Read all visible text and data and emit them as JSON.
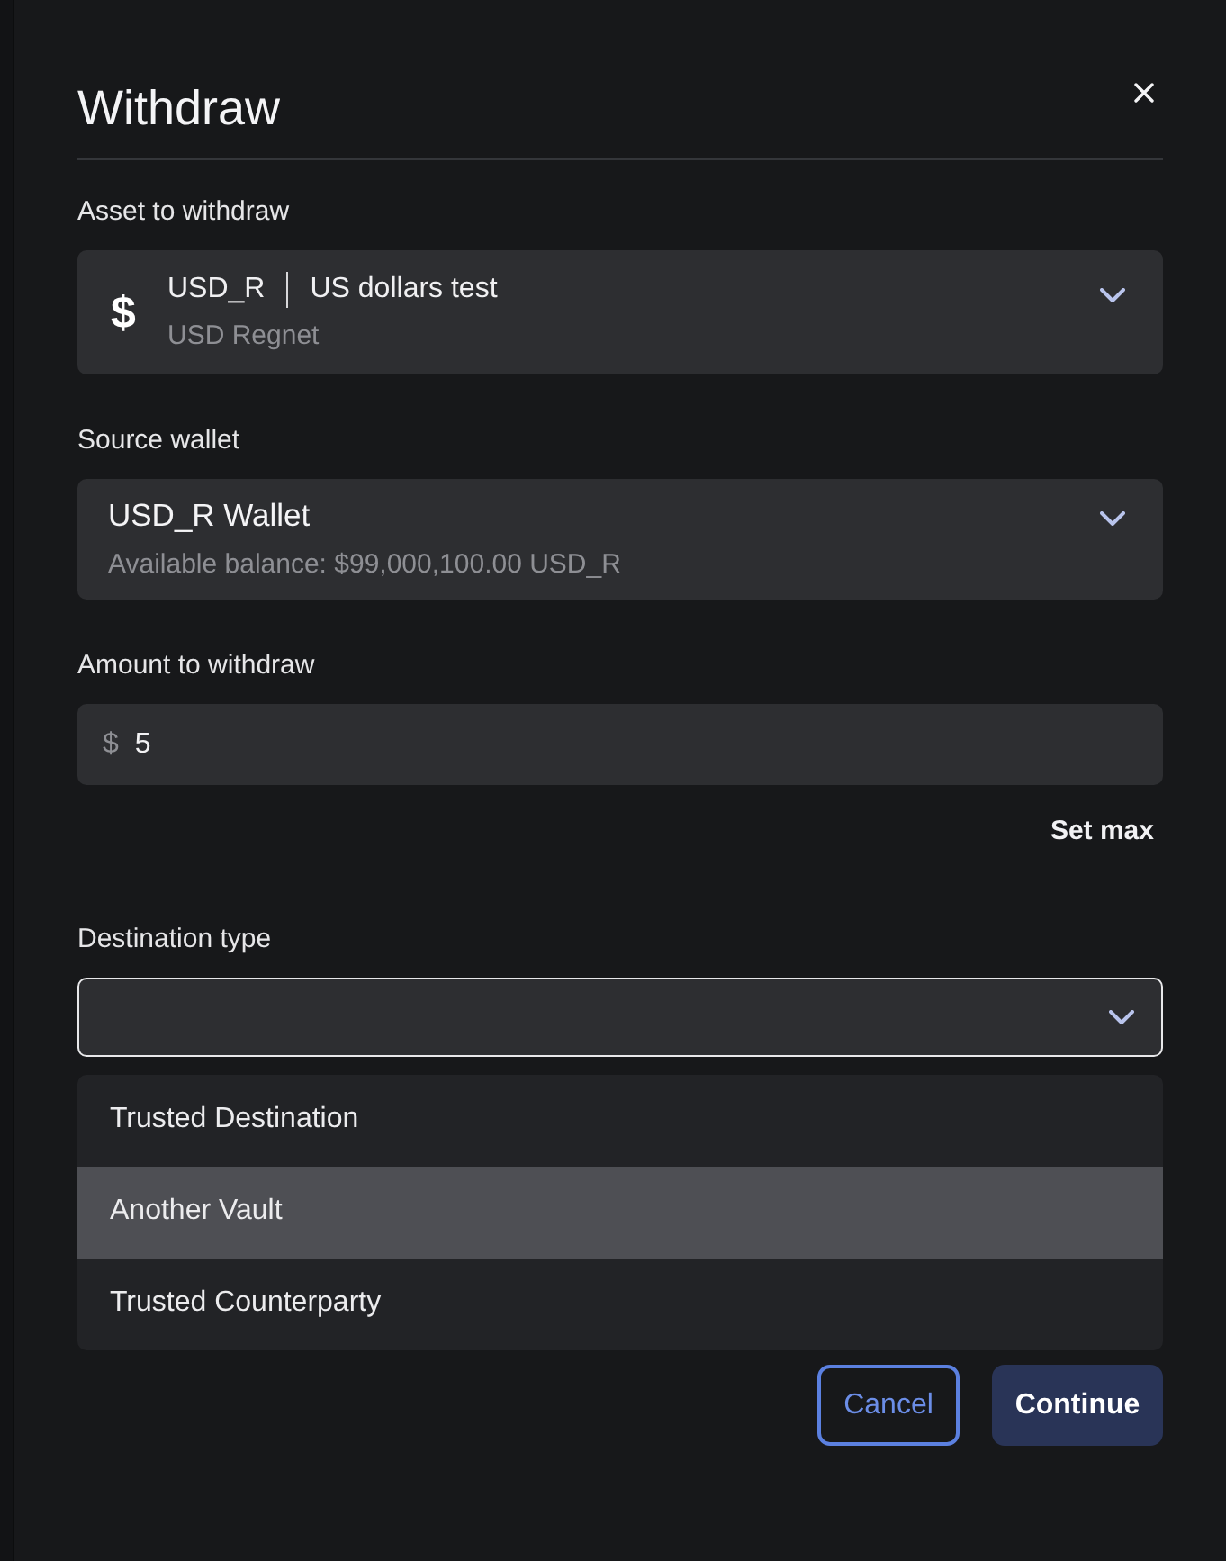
{
  "dialog": {
    "title": "Withdraw"
  },
  "asset": {
    "label": "Asset to withdraw",
    "symbol": "$",
    "code": "USD_R",
    "name": "US dollars test",
    "network": "USD Regnet"
  },
  "source_wallet": {
    "label": "Source wallet",
    "name": "USD_R Wallet",
    "balance": "Available balance: $99,000,100.00 USD_R"
  },
  "amount": {
    "label": "Amount to withdraw",
    "prefix": "$",
    "value": "5",
    "set_max": "Set max"
  },
  "destination_type": {
    "label": "Destination type",
    "focused": true,
    "expanded": true,
    "options": [
      {
        "label": "Trusted Destination",
        "selected": false
      },
      {
        "label": "Another Vault",
        "selected": true
      },
      {
        "label": "Trusted Counterparty",
        "selected": false
      }
    ]
  },
  "buttons": [
    {
      "label": "Cancel",
      "kind": "outline"
    },
    {
      "label": "Continue",
      "kind": "primary"
    }
  ]
}
